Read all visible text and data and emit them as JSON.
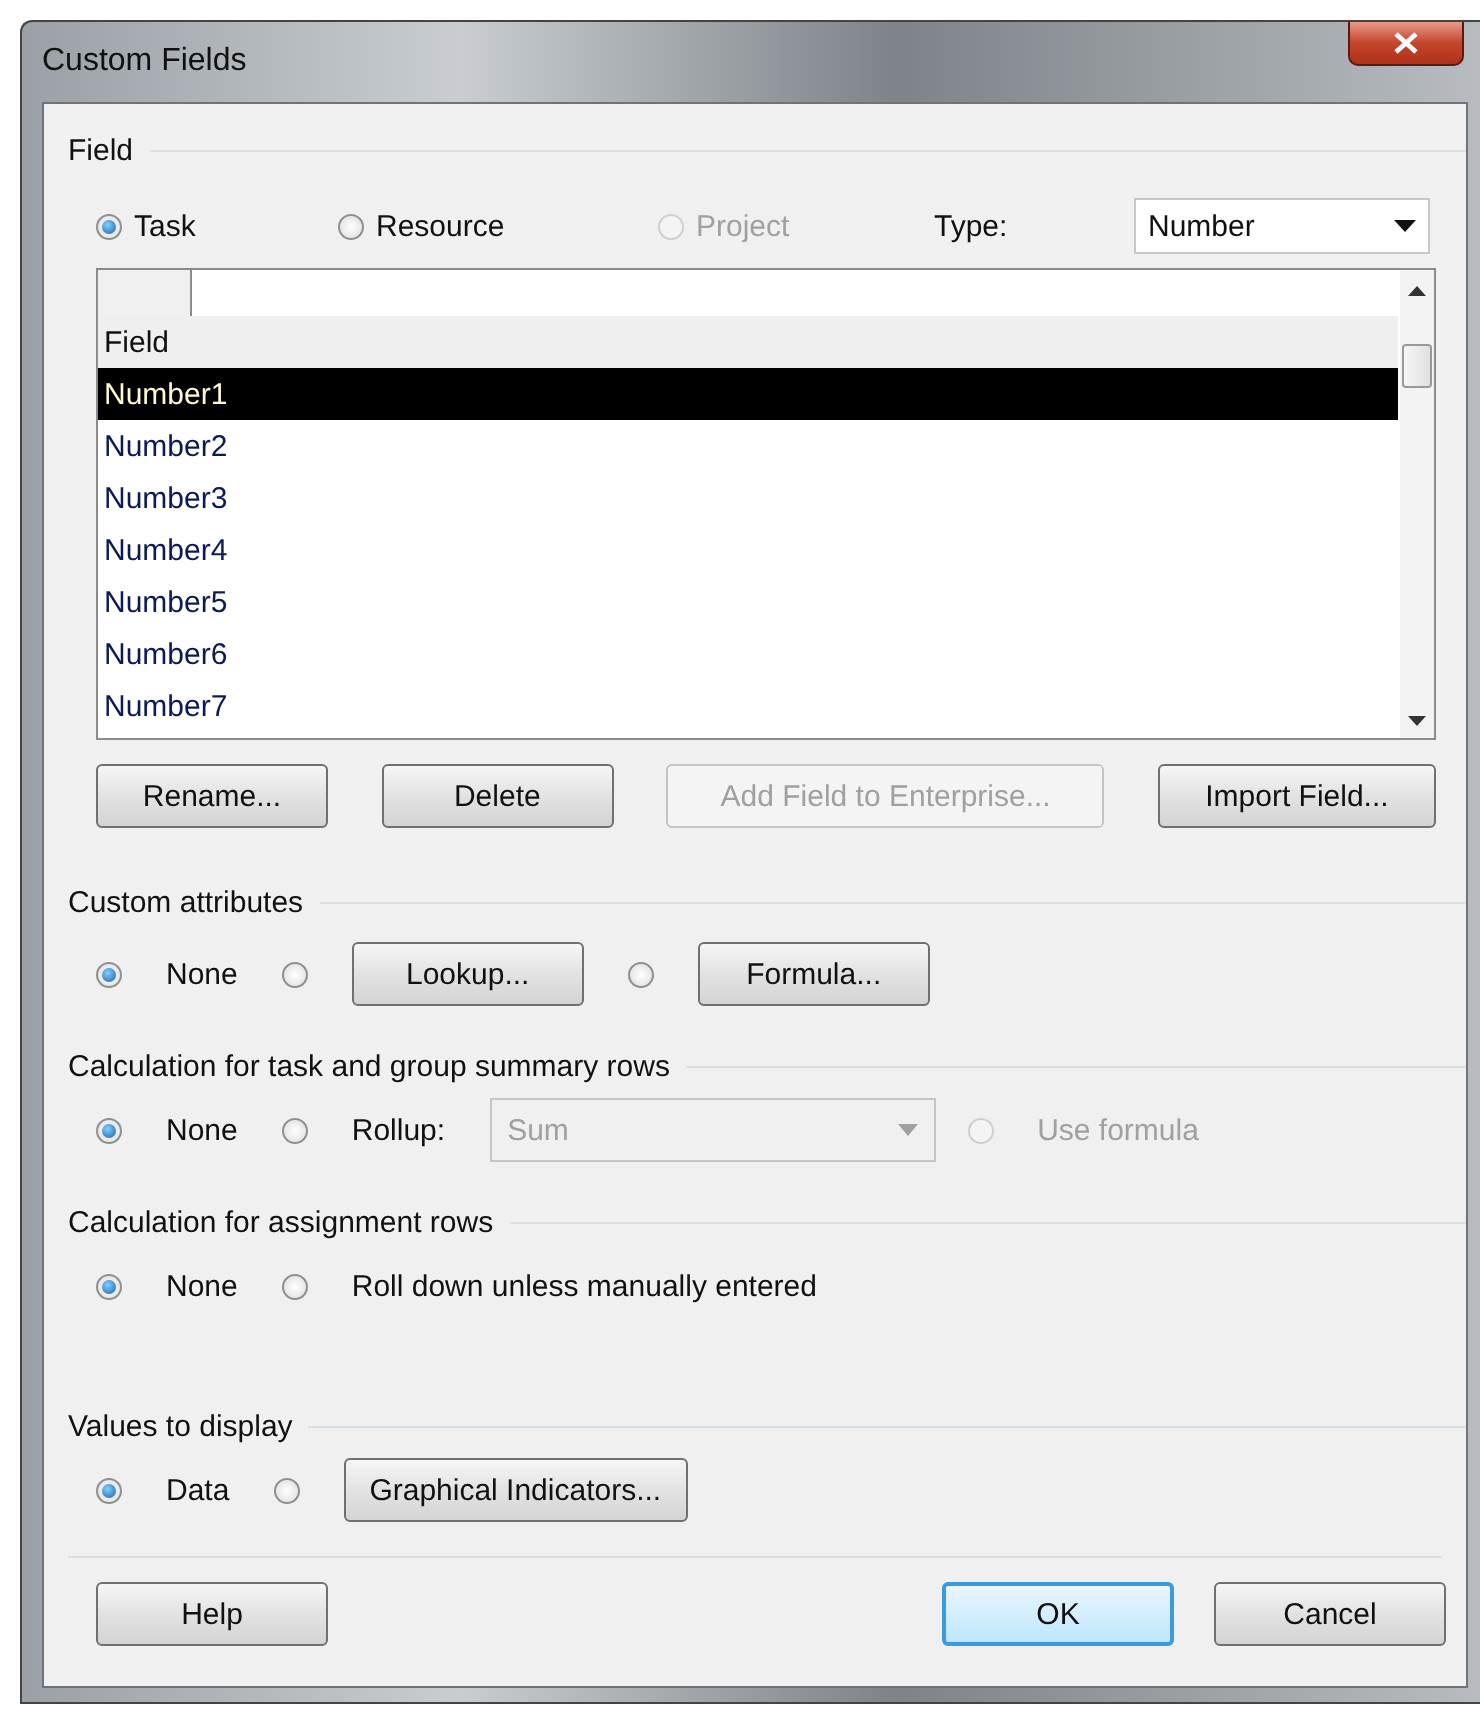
{
  "window": {
    "title": "Custom Fields"
  },
  "field_section": {
    "title": "Field",
    "scope": [
      {
        "label": "Task",
        "selected": true,
        "disabled": false
      },
      {
        "label": "Resource",
        "selected": false,
        "disabled": false
      },
      {
        "label": "Project",
        "selected": false,
        "disabled": true
      }
    ],
    "type_label": "Type:",
    "type_value": "Number"
  },
  "field_list": {
    "header": "Field",
    "rows": [
      {
        "label": "Number1",
        "selected": true
      },
      {
        "label": "Number2",
        "selected": false
      },
      {
        "label": "Number3",
        "selected": false
      },
      {
        "label": "Number4",
        "selected": false
      },
      {
        "label": "Number5",
        "selected": false
      },
      {
        "label": "Number6",
        "selected": false
      },
      {
        "label": "Number7",
        "selected": false
      }
    ]
  },
  "list_buttons": [
    {
      "label": "Rename...",
      "disabled": false
    },
    {
      "label": "Delete",
      "disabled": false
    },
    {
      "label": "Add Field to Enterprise...",
      "disabled": true
    },
    {
      "label": "Import Field...",
      "disabled": false
    }
  ],
  "sections": [
    {
      "title": "Custom attributes",
      "options": [
        {
          "kind": "radio",
          "label": "None",
          "selected": true,
          "disabled": false
        },
        {
          "kind": "radio-button",
          "label": "Lookup...",
          "selected": false,
          "disabled": false
        },
        {
          "kind": "radio-button",
          "label": "Formula...",
          "selected": false,
          "disabled": false
        }
      ]
    },
    {
      "title": "Calculation for task and group summary rows",
      "options": [
        {
          "kind": "radio",
          "label": "None",
          "selected": true,
          "disabled": false
        },
        {
          "kind": "radio",
          "label": "Rollup:",
          "selected": false,
          "disabled": false
        },
        {
          "kind": "dropdown",
          "value": "Sum",
          "disabled": true
        },
        {
          "kind": "radio",
          "label": "Use formula",
          "selected": false,
          "disabled": true
        }
      ]
    },
    {
      "title": "Calculation for assignment rows",
      "options": [
        {
          "kind": "radio",
          "label": "None",
          "selected": true,
          "disabled": false
        },
        {
          "kind": "radio",
          "label": "Roll down unless manually entered",
          "selected": false,
          "disabled": false
        }
      ]
    },
    {
      "title": "Values to display",
      "options": [
        {
          "kind": "radio",
          "label": "Data",
          "selected": true,
          "disabled": false
        },
        {
          "kind": "radio-button",
          "label": "Graphical Indicators...",
          "selected": false,
          "disabled": false
        }
      ]
    }
  ],
  "footer_buttons": [
    {
      "label": "Help",
      "default": false
    },
    {
      "label": "OK",
      "default": true
    },
    {
      "label": "Cancel",
      "default": false
    }
  ]
}
